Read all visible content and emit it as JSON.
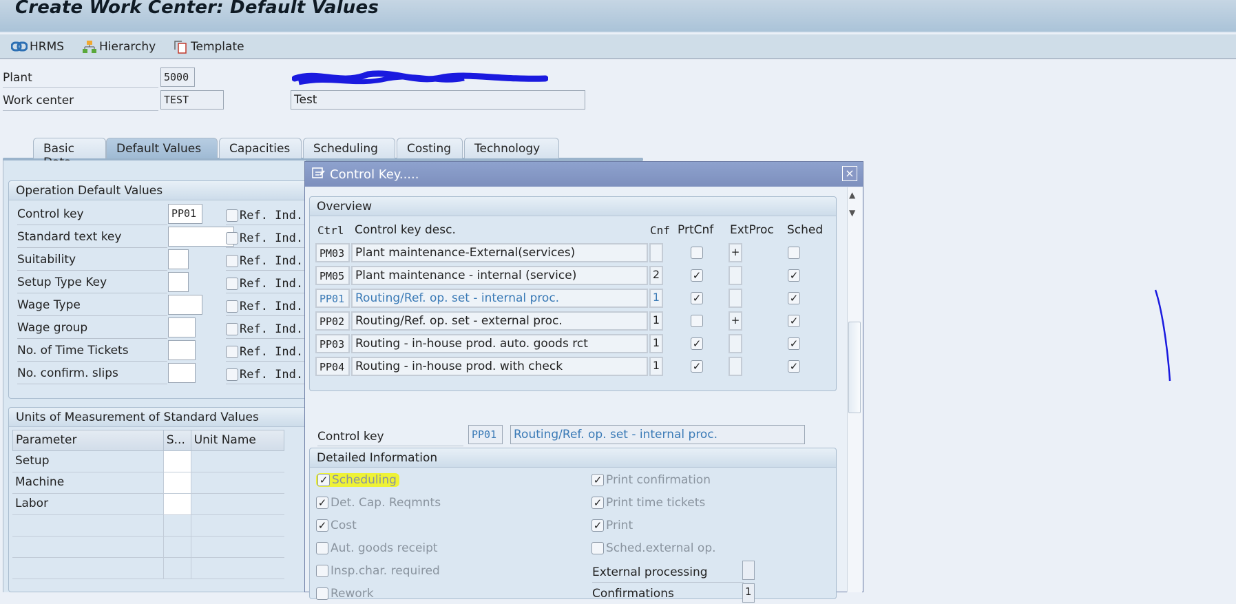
{
  "window": {
    "title": "Create Work Center: Default Values"
  },
  "toolbar": {
    "buttons": [
      {
        "label": "HRMS",
        "icon": "link-icon"
      },
      {
        "label": "Hierarchy",
        "icon": "hierarchy-icon"
      },
      {
        "label": "Template",
        "icon": "template-icon"
      }
    ]
  },
  "header": {
    "plant_label": "Plant",
    "plant_value": "5000",
    "work_center_label": "Work center",
    "work_center_value": "TEST",
    "work_center_desc": "Test"
  },
  "tabs": [
    {
      "label": "Basic Data",
      "active": false
    },
    {
      "label": "Default Values",
      "active": true
    },
    {
      "label": "Capacities",
      "active": false
    },
    {
      "label": "Scheduling",
      "active": false
    },
    {
      "label": "Costing",
      "active": false
    },
    {
      "label": "Technology",
      "active": false
    }
  ],
  "operation_defaults": {
    "title": "Operation Default Values",
    "ref_label": "Ref. Ind.",
    "rows": [
      {
        "label": "Control key",
        "value": "PP01",
        "ref_checked": false
      },
      {
        "label": "Standard text key",
        "value": "",
        "ref_checked": false
      },
      {
        "label": "Suitability",
        "value": "",
        "ref_checked": false
      },
      {
        "label": "Setup Type Key",
        "value": "",
        "ref_checked": false
      },
      {
        "label": "Wage Type",
        "value": "",
        "ref_checked": false
      },
      {
        "label": "Wage group",
        "value": "",
        "ref_checked": false
      },
      {
        "label": "No. of Time Tickets",
        "value": "",
        "ref_checked": false
      },
      {
        "label": "No. confirm. slips",
        "value": "",
        "ref_checked": false
      }
    ]
  },
  "uom": {
    "title": "Units of Measurement of Standard Values",
    "columns": [
      "Parameter",
      "S...",
      "Unit Name"
    ],
    "rows": [
      {
        "parameter": "Setup",
        "s": "",
        "unit": ""
      },
      {
        "parameter": "Machine",
        "s": "",
        "unit": ""
      },
      {
        "parameter": "Labor",
        "s": "",
        "unit": ""
      },
      {
        "parameter": "",
        "s": "",
        "unit": ""
      },
      {
        "parameter": "",
        "s": "",
        "unit": ""
      },
      {
        "parameter": "",
        "s": "",
        "unit": ""
      }
    ]
  },
  "dialog": {
    "title": "Control Key.....",
    "close_label": "×",
    "overview": {
      "title": "Overview",
      "columns": {
        "ctrl": "Ctrl",
        "desc": "Control key desc.",
        "cnf": "Cnf",
        "prtcnf": "PrtCnf",
        "extproc": "ExtProc",
        "sched": "Sched"
      },
      "rows": [
        {
          "ctrl": "PM03",
          "desc": "Plant maintenance-External(services)",
          "cnf": "",
          "prtcnf": false,
          "extproc": "+",
          "sched": false,
          "selected": false
        },
        {
          "ctrl": "PM05",
          "desc": "Plant maintenance - internal (service)",
          "cnf": "2",
          "prtcnf": true,
          "extproc": "",
          "sched": true,
          "selected": false
        },
        {
          "ctrl": "PP01",
          "desc": "Routing/Ref. op. set - internal proc.",
          "cnf": "1",
          "prtcnf": true,
          "extproc": "",
          "sched": true,
          "selected": true
        },
        {
          "ctrl": "PP02",
          "desc": "Routing/Ref. op. set - external proc.",
          "cnf": "1",
          "prtcnf": false,
          "extproc": "+",
          "sched": true,
          "selected": false
        },
        {
          "ctrl": "PP03",
          "desc": "Routing - in-house prod. auto. goods rct",
          "cnf": "1",
          "prtcnf": true,
          "extproc": "",
          "sched": true,
          "selected": false
        },
        {
          "ctrl": "PP04",
          "desc": "Routing - in-house prod. with check",
          "cnf": "1",
          "prtcnf": true,
          "extproc": "",
          "sched": true,
          "selected": false
        }
      ]
    },
    "control_key": {
      "label": "Control key",
      "value": "PP01",
      "desc": "Routing/Ref. op. set - internal proc."
    },
    "detail": {
      "title": "Detailed Information",
      "left": [
        {
          "label": "Scheduling",
          "checked": true,
          "highlighted": true
        },
        {
          "label": "Det. Cap. Reqmnts",
          "checked": true
        },
        {
          "label": "Cost",
          "checked": true
        },
        {
          "label": "Aut. goods receipt",
          "checked": false
        },
        {
          "label": "Insp.char. required",
          "checked": false
        },
        {
          "label": "Rework",
          "checked": false
        }
      ],
      "right": [
        {
          "label": "Print confirmation",
          "checked": true
        },
        {
          "label": "Print time tickets",
          "checked": true
        },
        {
          "label": "Print",
          "checked": true
        },
        {
          "label": "Sched.external op.",
          "checked": false
        }
      ],
      "external_processing_label": "External processing",
      "external_processing_value": "",
      "confirmations_label": "Confirmations",
      "confirmations_value": "1"
    }
  },
  "colors": {
    "highlight": "#eef236",
    "annotation": "#1a1adf",
    "selected_row_text": "#3a7ab6"
  }
}
